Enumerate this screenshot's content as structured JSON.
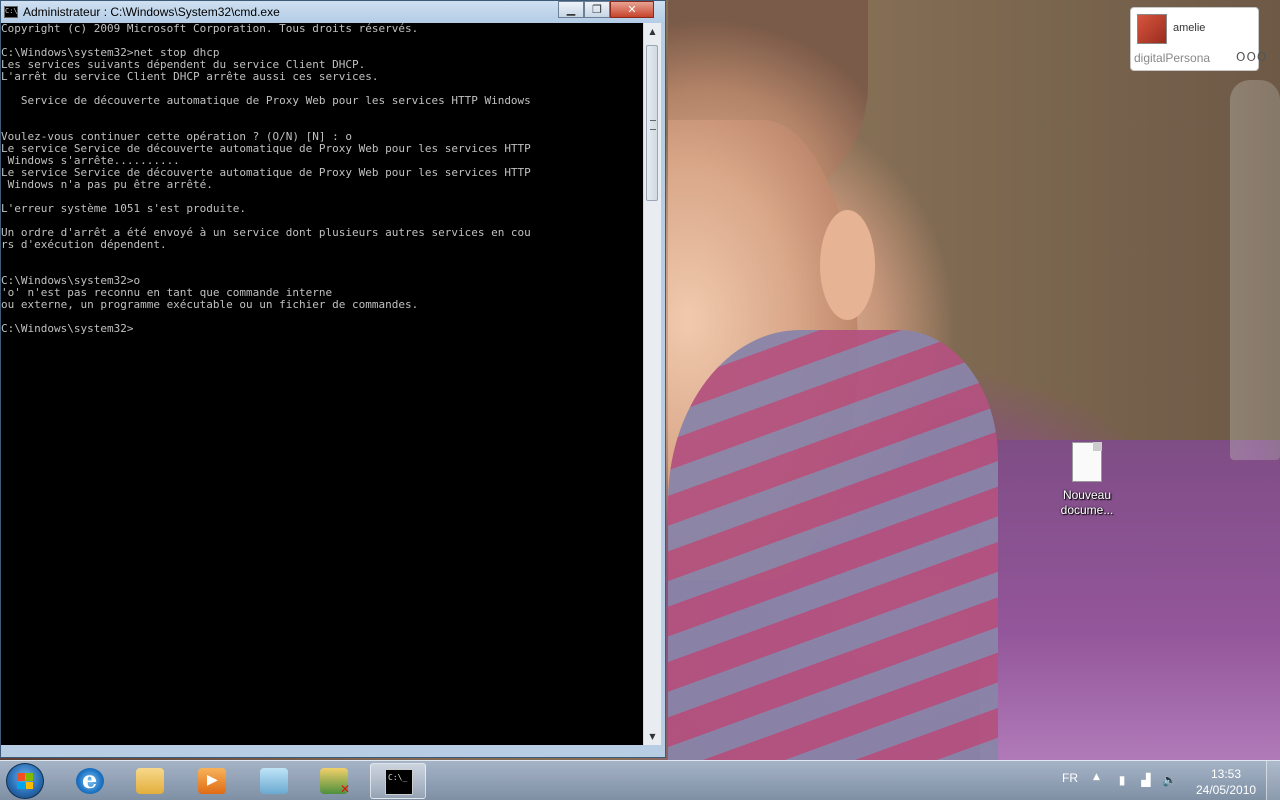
{
  "window": {
    "title": "Administrateur : C:\\Windows\\System32\\cmd.exe",
    "minimize": "▁",
    "maximize": "❐",
    "close": "✕",
    "titlebar_icon": "C:\\"
  },
  "console_lines": [
    "Copyright (c) 2009 Microsoft Corporation. Tous droits réservés.",
    "",
    "C:\\Windows\\system32>net stop dhcp",
    "Les services suivants dépendent du service Client DHCP.",
    "L'arrêt du service Client DHCP arrête aussi ces services.",
    "",
    "   Service de découverte automatique de Proxy Web pour les services HTTP Windows",
    "",
    "",
    "Voulez-vous continuer cette opération ? (O/N) [N] : o",
    "Le service Service de découverte automatique de Proxy Web pour les services HTTP",
    " Windows s'arrête..........",
    "Le service Service de découverte automatique de Proxy Web pour les services HTTP",
    " Windows n'a pas pu être arrêté.",
    "",
    "L'erreur système 1051 s'est produite.",
    "",
    "Un ordre d'arrêt a été envoyé à un service dont plusieurs autres services en cou",
    "rs d'exécution dépendent.",
    "",
    "",
    "C:\\Windows\\system32>o",
    "'o' n'est pas reconnu en tant que commande interne",
    "ou externe, un programme exécutable ou un fichier de commandes.",
    "",
    "C:\\Windows\\system32>"
  ],
  "scrollbar": {
    "up": "▲",
    "down": "▼"
  },
  "digitalpersona": {
    "user": "amelie",
    "brand": "digitalPersona",
    "dots": "OOO"
  },
  "desktop_icon": {
    "label_line1": "Nouveau",
    "label_line2": "docume..."
  },
  "taskbar": {
    "items": [
      "start-button",
      "internet-explorer-icon",
      "folder-icon",
      "media-player-icon",
      "network-icon",
      "user-accounts-icon",
      "cmd-icon"
    ],
    "language": "FR",
    "tray_up": "▲",
    "time": "13:53",
    "date": "24/05/2010"
  },
  "colors": {
    "console_bg": "#000000",
    "console_text": "#c0c0c0",
    "close_button": "#c7432b"
  }
}
